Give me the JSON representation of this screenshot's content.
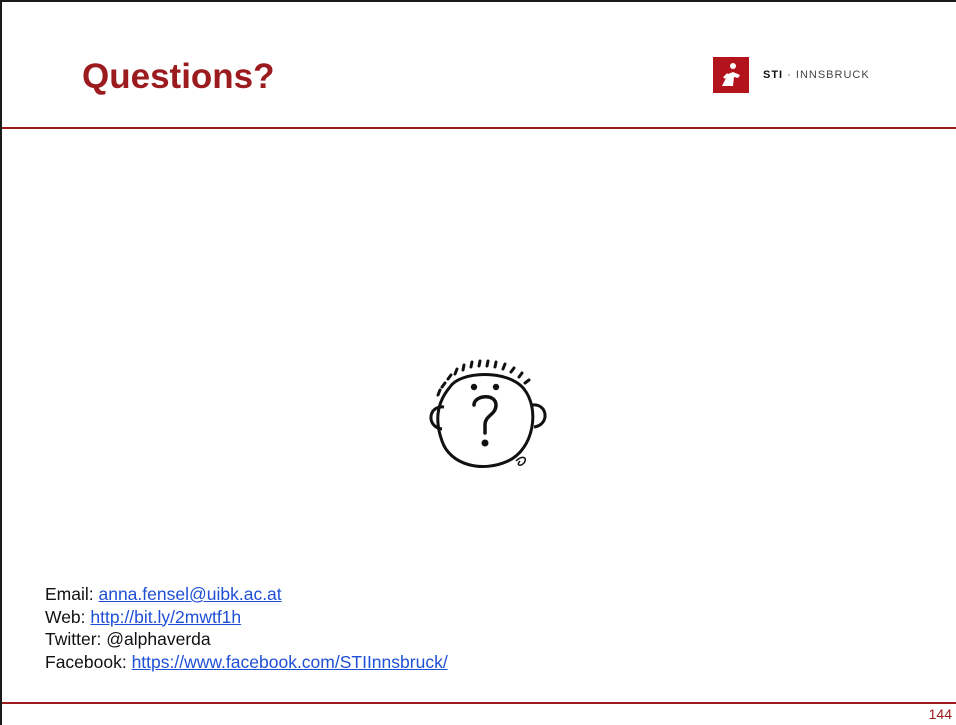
{
  "slide": {
    "title": "Questions?",
    "logo": {
      "brand_bold": "STI",
      "brand_rest": " · INNSBRUCK",
      "accent_color": "#b3131b"
    },
    "illustration": "question-face-icon",
    "contacts": [
      {
        "label": "Email: ",
        "value": "anna.fensel@uibk.ac.at",
        "is_link": true
      },
      {
        "label": "Web: ",
        "value": "http://bit.ly/2mwtf1h",
        "is_link": true
      },
      {
        "label": "Twitter: ",
        "value": "@alphaverda",
        "is_link": false
      },
      {
        "label": "Facebook: ",
        "value": "https://www.facebook.com/STIInnsbruck/",
        "is_link": true
      }
    ],
    "page_number": "144",
    "colors": {
      "title": "#9b1b1f",
      "link": "#1f4fd6"
    }
  }
}
